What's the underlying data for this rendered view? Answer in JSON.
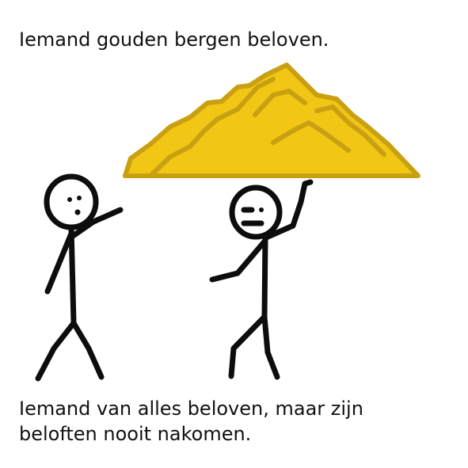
{
  "title": "Iemand gouden bergen beloven.",
  "explanation": "Iemand van alles beloven, maar zijn beloften nooit nakomen.",
  "colors": {
    "gold_fill": "#F2C614",
    "gold_stroke": "#C9A012",
    "ink": "#0d0d0d"
  }
}
